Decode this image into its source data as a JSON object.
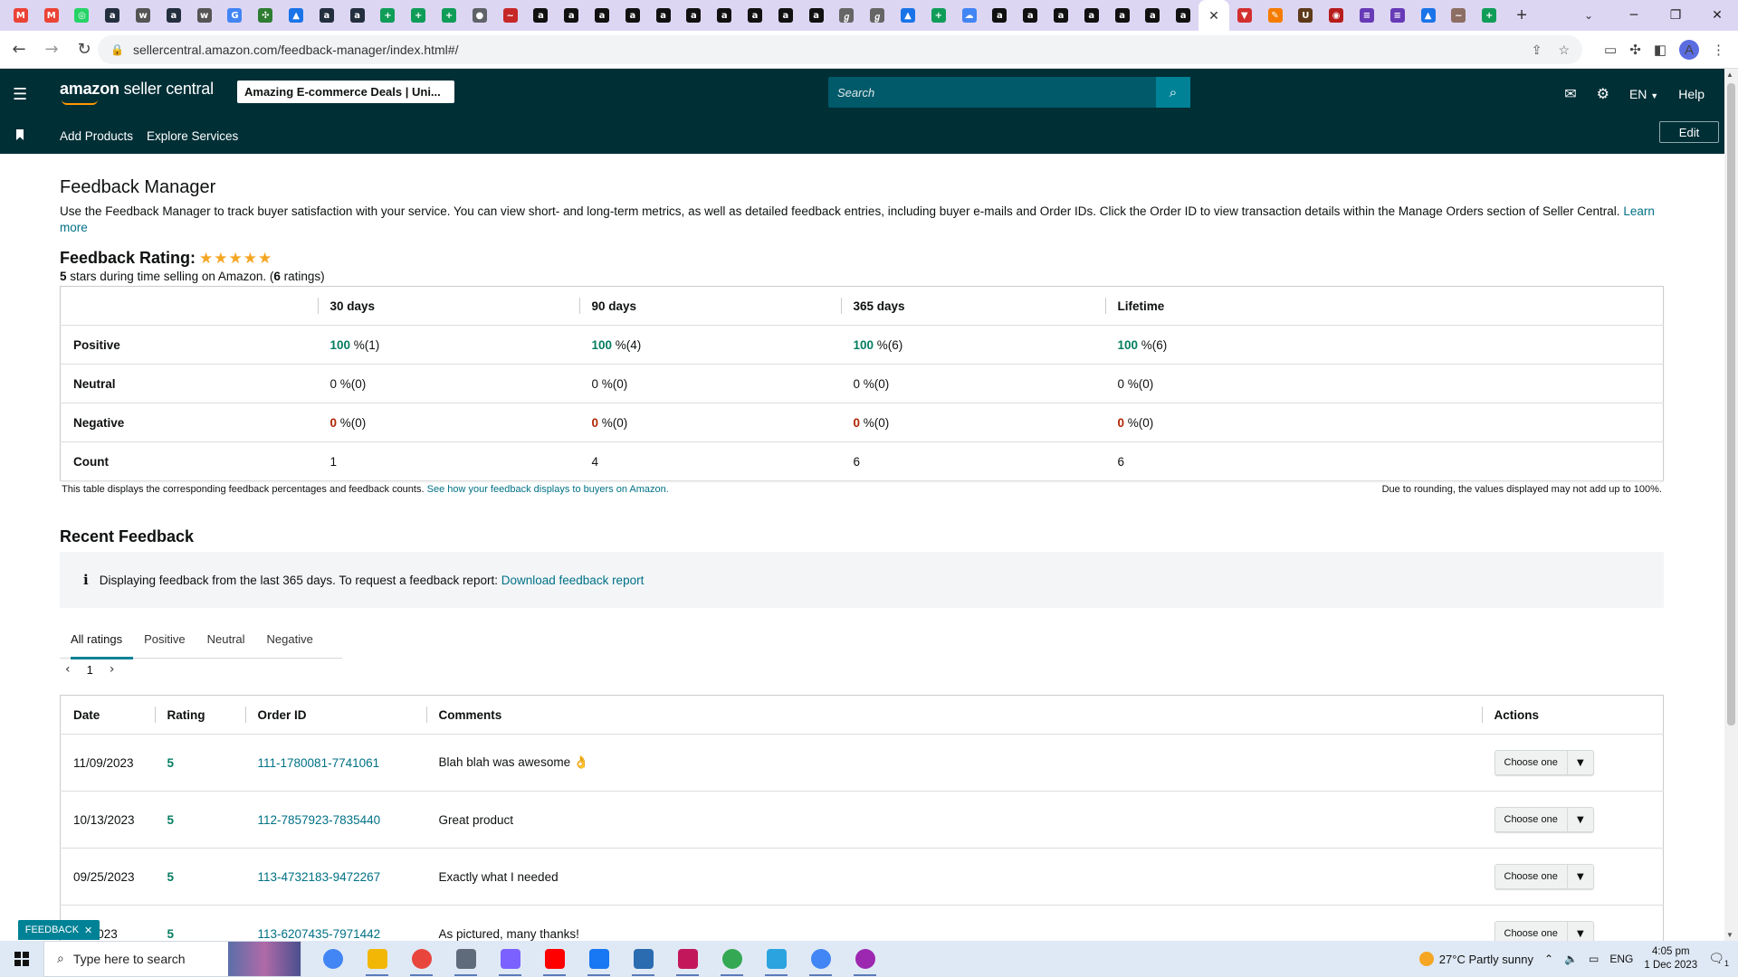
{
  "browser": {
    "tabs": [
      {
        "icon": "gmail-icon",
        "color": "#ea4335",
        "glyph": "M"
      },
      {
        "icon": "gmail-icon",
        "color": "#ea4335",
        "glyph": "M"
      },
      {
        "icon": "whatsapp-icon",
        "color": "#25d366",
        "glyph": "◎"
      },
      {
        "icon": "amazon-icon",
        "color": "#232f3e",
        "glyph": "a"
      },
      {
        "icon": "wix-icon",
        "color": "#555555",
        "glyph": "w"
      },
      {
        "icon": "amazon-icon",
        "color": "#232f3e",
        "glyph": "a"
      },
      {
        "icon": "wix-icon",
        "color": "#555555",
        "glyph": "w"
      },
      {
        "icon": "google-icon",
        "color": "#4285f4",
        "glyph": "G"
      },
      {
        "icon": "puzzle-icon",
        "color": "#2e7d32",
        "glyph": "✣"
      },
      {
        "icon": "drive-icon",
        "color": "#1a73e8",
        "glyph": "▲"
      },
      {
        "icon": "amazon-icon",
        "color": "#232f3e",
        "glyph": "a"
      },
      {
        "icon": "amazon-icon",
        "color": "#232f3e",
        "glyph": "a"
      },
      {
        "icon": "sheets-icon",
        "color": "#0f9d58",
        "glyph": "+"
      },
      {
        "icon": "sheets-icon",
        "color": "#0f9d58",
        "glyph": "+"
      },
      {
        "icon": "sheets-icon",
        "color": "#0f9d58",
        "glyph": "+"
      },
      {
        "icon": "globe-icon",
        "color": "#5f6368",
        "glyph": "●"
      },
      {
        "icon": "site-icon",
        "color": "#c62828",
        "glyph": "~"
      },
      {
        "icon": "amazon-box-icon",
        "color": "#111111",
        "glyph": "a"
      },
      {
        "icon": "amazon-box-icon",
        "color": "#111111",
        "glyph": "a"
      },
      {
        "icon": "amazon-box-icon",
        "color": "#111111",
        "glyph": "a"
      },
      {
        "icon": "amazon-box-icon",
        "color": "#111111",
        "glyph": "a"
      },
      {
        "icon": "amazon-box-icon",
        "color": "#111111",
        "glyph": "a"
      },
      {
        "icon": "amazon-box-icon",
        "color": "#111111",
        "glyph": "a"
      },
      {
        "icon": "amazon-box-icon",
        "color": "#111111",
        "glyph": "a"
      },
      {
        "icon": "amazon-box-icon",
        "color": "#111111",
        "glyph": "a"
      },
      {
        "icon": "amazon-box-icon",
        "color": "#111111",
        "glyph": "a"
      },
      {
        "icon": "amazon-box-icon",
        "color": "#111111",
        "glyph": "a"
      },
      {
        "icon": "script-icon",
        "color": "#666666",
        "glyph": "ℊ"
      },
      {
        "icon": "script-icon",
        "color": "#666666",
        "glyph": "ℊ"
      },
      {
        "icon": "drive-icon",
        "color": "#1a73e8",
        "glyph": "▲"
      },
      {
        "icon": "sheets-icon",
        "color": "#0f9d58",
        "glyph": "+"
      },
      {
        "icon": "cloud-icon",
        "color": "#4285f4",
        "glyph": "☁"
      },
      {
        "icon": "amazon-box-icon",
        "color": "#111111",
        "glyph": "a"
      },
      {
        "icon": "amazon-box-icon",
        "color": "#111111",
        "glyph": "a"
      },
      {
        "icon": "amazon-box-icon",
        "color": "#111111",
        "glyph": "a"
      },
      {
        "icon": "amazon-box-icon",
        "color": "#111111",
        "glyph": "a"
      },
      {
        "icon": "amazon-box-icon",
        "color": "#111111",
        "glyph": "a"
      },
      {
        "icon": "amazon-box-icon",
        "color": "#111111",
        "glyph": "a"
      },
      {
        "icon": "amazon-box-icon",
        "color": "#111111",
        "glyph": "a"
      },
      {
        "icon": "close-icon",
        "color": "#333333",
        "glyph": "✕",
        "active": true
      },
      {
        "icon": "vivaldi-icon",
        "color": "#d32f2f",
        "glyph": "▼"
      },
      {
        "icon": "pencil-icon",
        "color": "#f57c00",
        "glyph": "✎"
      },
      {
        "icon": "ups-icon",
        "color": "#5d3a1a",
        "glyph": "U"
      },
      {
        "icon": "shop-icon",
        "color": "#b71c1c",
        "glyph": "◉"
      },
      {
        "icon": "forms-icon",
        "color": "#673ab7",
        "glyph": "≡"
      },
      {
        "icon": "forms-icon",
        "color": "#673ab7",
        "glyph": "≡"
      },
      {
        "icon": "drive-icon",
        "color": "#1a73e8",
        "glyph": "▲"
      },
      {
        "icon": "wish-icon",
        "color": "#8d6e63",
        "glyph": "~"
      },
      {
        "icon": "sheets-icon",
        "color": "#0f9d58",
        "glyph": "+"
      }
    ],
    "new_tab": "+",
    "url": "sellercentral.amazon.com/feedback-manager/index.html#/"
  },
  "header": {
    "logo_bold": "amazon",
    "logo_rest": " seller central",
    "store": "Amazing E-commerce Deals | Uni...",
    "search_placeholder": "Search",
    "lang": "EN",
    "help": "Help",
    "nav": [
      "Add Products",
      "Explore Services"
    ],
    "edit": "Edit"
  },
  "page": {
    "title": "Feedback Manager",
    "intro": "Use the Feedback Manager to track buyer satisfaction with your service. You can view short- and long-term metrics, as well as detailed feedback entries, including buyer e-mails and Order IDs. Click the Order ID to view transaction details within the Manage Orders section of Seller Central.",
    "learn_more": "Learn more",
    "rating_label": "Feedback Rating:",
    "star_count": 5,
    "rating_stars": "5",
    "rating_text_a": " stars during time selling on Amazon. (",
    "rating_count": "6",
    "rating_text_b": " ratings)"
  },
  "summary": {
    "columns": [
      "30 days",
      "90 days",
      "365 days",
      "Lifetime"
    ],
    "rows": [
      {
        "label": "Positive",
        "kind": "green",
        "cells": [
          [
            "100",
            " %(1)"
          ],
          [
            "100",
            " %(4)"
          ],
          [
            "100",
            " %(6)"
          ],
          [
            "100",
            " %(6)"
          ]
        ]
      },
      {
        "label": "Neutral",
        "kind": "plain",
        "cells": [
          [
            "0",
            " %(0)"
          ],
          [
            "0",
            " %(0)"
          ],
          [
            "0",
            " %(0)"
          ],
          [
            "0",
            " %(0)"
          ]
        ]
      },
      {
        "label": "Negative",
        "kind": "red",
        "cells": [
          [
            "0",
            " %(0)"
          ],
          [
            "0",
            " %(0)"
          ],
          [
            "0",
            " %(0)"
          ],
          [
            "0",
            " %(0)"
          ]
        ]
      },
      {
        "label": "Count",
        "kind": "plain",
        "cells": [
          [
            "1",
            ""
          ],
          [
            "4",
            ""
          ],
          [
            "6",
            ""
          ],
          [
            "6",
            ""
          ]
        ]
      }
    ],
    "note": "This table displays the corresponding feedback percentages and feedback counts.",
    "note_link": "See how your feedback displays to buyers on Amazon.",
    "note_right": "Due to rounding, the values displayed may not add up to 100%."
  },
  "recent": {
    "title": "Recent Feedback",
    "info": "Displaying feedback from the last 365 days. To request a feedback report:",
    "info_link": "Download feedback report",
    "tabs": [
      "All ratings",
      "Positive",
      "Neutral",
      "Negative"
    ],
    "active_tab": 0,
    "page": "1",
    "columns": [
      "Date",
      "Rating",
      "Order ID",
      "Comments",
      "Actions"
    ],
    "rows": [
      {
        "date": "11/09/2023",
        "rating": "5",
        "order": "111-1780081-7741061",
        "comment": "Blah blah was awesome 👌"
      },
      {
        "date": "10/13/2023",
        "rating": "5",
        "order": "112-7857923-7835440",
        "comment": "Great product"
      },
      {
        "date": "09/25/2023",
        "rating": "5",
        "order": "113-4732183-9472267",
        "comment": "Exactly what I needed"
      },
      {
        "date": "08/2023",
        "rating": "5",
        "order": "113-6207435-7971442",
        "comment": "As pictured, many thanks!"
      }
    ],
    "action_label": "Choose one"
  },
  "feedback_badge": "FEEDBACK",
  "taskbar": {
    "search_placeholder": "Type here to search",
    "apps": [
      {
        "icon": "chrome-icon",
        "color": "#4285f4"
      },
      {
        "icon": "file-explorer-icon",
        "color": "#f2b705"
      },
      {
        "icon": "chrome-icon",
        "color": "#e8453c"
      },
      {
        "icon": "calculator-icon",
        "color": "#5f6b7a"
      },
      {
        "icon": "copilot-icon",
        "color": "#7b61ff"
      },
      {
        "icon": "youtube-icon",
        "color": "#ff0000"
      },
      {
        "icon": "facebook-icon",
        "color": "#1877f2"
      },
      {
        "icon": "store-icon",
        "color": "#2b6cb0"
      },
      {
        "icon": "snipping-icon",
        "color": "#c2185b"
      },
      {
        "icon": "chrome-icon",
        "color": "#34a853"
      },
      {
        "icon": "telegram-icon",
        "color": "#2aa3df"
      },
      {
        "icon": "chrome-icon",
        "color": "#4285f4"
      },
      {
        "icon": "chrome-icon",
        "color": "#9c27b0"
      }
    ],
    "weather": "27°C  Partly sunny",
    "lang": "ENG",
    "time": "4:05 pm",
    "date": "1 Dec 2023",
    "notification_count": "1"
  }
}
